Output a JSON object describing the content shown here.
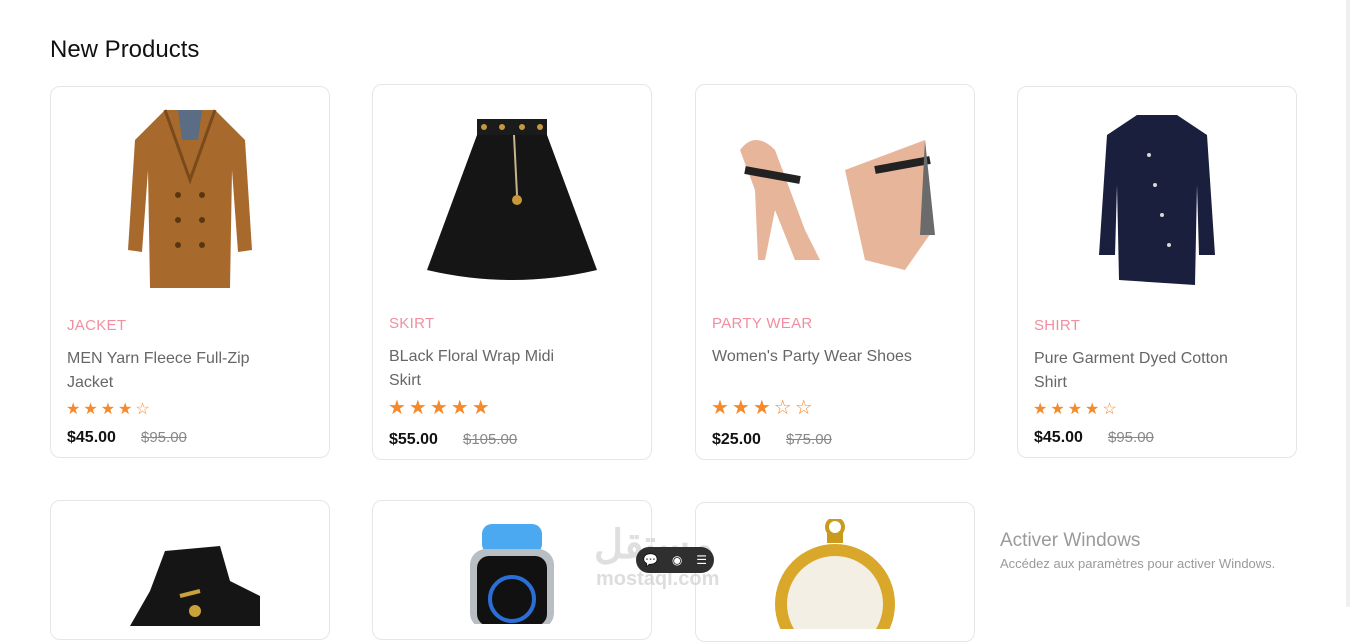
{
  "section": {
    "title": "New Products"
  },
  "products": [
    {
      "category": "JACKET",
      "name": "MEN Yarn Fleece Full-Zip Jacket",
      "rating": 4,
      "rating_max": 5,
      "price": "$45.00",
      "old_price": "$95.00",
      "image": "brown-coat-image"
    },
    {
      "category": "SKIRT",
      "name": "BLack Floral Wrap Midi Skirt",
      "rating": 5,
      "rating_max": 5,
      "price": "$55.00",
      "old_price": "$105.00",
      "image": "black-skirt-image"
    },
    {
      "category": "PARTY WEAR",
      "name": "Women's Party Wear Shoes",
      "rating": 3,
      "rating_max": 5,
      "price": "$25.00",
      "old_price": "$75.00",
      "image": "party-heels-image"
    },
    {
      "category": "SHIRT",
      "name": "Pure Garment Dyed Cotton Shirt",
      "rating": 4,
      "rating_max": 5,
      "price": "$45.00",
      "old_price": "$95.00",
      "image": "navy-shirt-image"
    },
    {
      "image": "black-sneaker-image"
    },
    {
      "image": "smart-watch-image"
    },
    {
      "image": "pocket-watch-image"
    }
  ],
  "windows_notice": {
    "title": "Activer Windows",
    "subtitle": "Accédez aux paramètres pour activer Windows."
  },
  "watermark": {
    "arabic": "مستقل",
    "latin": "mostaql.com"
  },
  "colors": {
    "category": "#f08fa0",
    "star": "#f5892b",
    "price": "#111111",
    "old_price": "#888888"
  }
}
